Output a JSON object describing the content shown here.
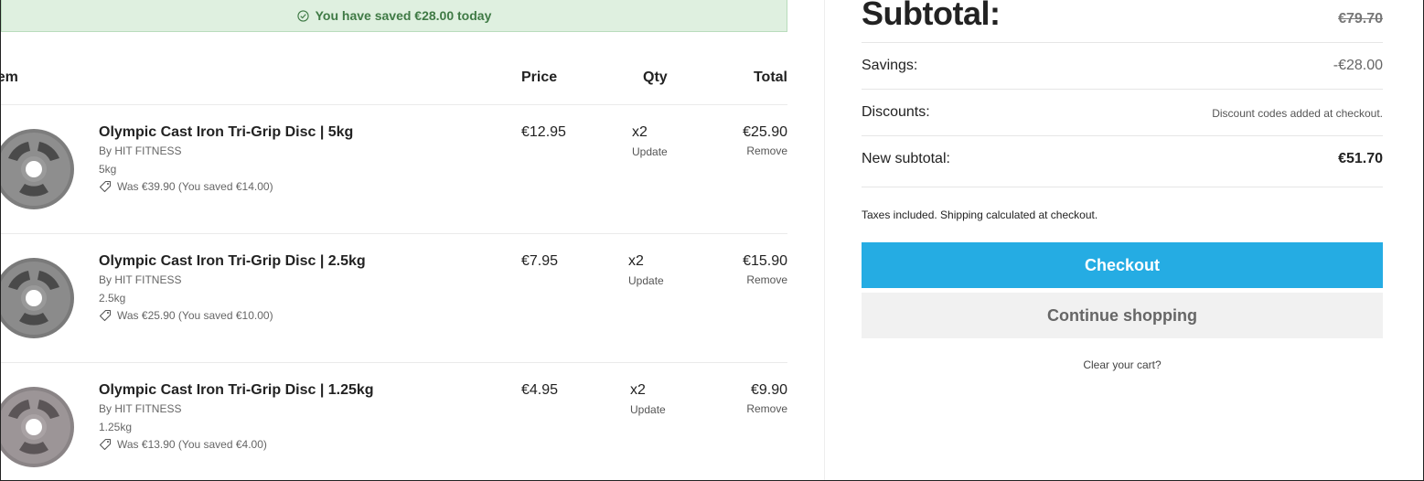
{
  "banner": {
    "text": "You have saved €28.00 today",
    "icon": "check-circle-icon"
  },
  "table": {
    "headers": {
      "item": "Item",
      "price": "Price",
      "qty": "Qty",
      "total": "Total"
    },
    "rows": [
      {
        "title": "Olympic Cast Iron Tri-Grip Disc | 5kg",
        "brand": "By HIT FITNESS",
        "variant": "5kg",
        "was": "Was €39.90 (You saved €14.00)",
        "price": "€12.95",
        "qty": "x2",
        "update": "Update",
        "total": "€25.90",
        "remove": "Remove"
      },
      {
        "title": "Olympic Cast Iron Tri-Grip Disc | 2.5kg",
        "brand": "By HIT FITNESS",
        "variant": "2.5kg",
        "was": "Was €25.90 (You saved €10.00)",
        "price": "€7.95",
        "qty": "x2",
        "update": "Update",
        "total": "€15.90",
        "remove": "Remove"
      },
      {
        "title": "Olympic Cast Iron Tri-Grip Disc | 1.25kg",
        "brand": "By HIT FITNESS",
        "variant": "1.25kg",
        "was": "Was €13.90 (You saved €4.00)",
        "price": "€4.95",
        "qty": "x2",
        "update": "Update",
        "total": "€9.90",
        "remove": "Remove"
      }
    ]
  },
  "summary": {
    "subtotal_label": "Subtotal:",
    "subtotal_value": "€79.70",
    "savings_label": "Savings:",
    "savings_value": "-€28.00",
    "discounts_label": "Discounts:",
    "discounts_value": "Discount codes added at checkout.",
    "new_subtotal_label": "New subtotal:",
    "new_subtotal_value": "€51.70",
    "taxes_note": "Taxes included. Shipping calculated at checkout.",
    "checkout_label": "Checkout",
    "continue_label": "Continue shopping",
    "clear_label": "Clear your cart?"
  },
  "colors": {
    "checkout": "#25ace3",
    "banner_bg": "#dff0e0",
    "banner_text": "#3f7a45"
  }
}
